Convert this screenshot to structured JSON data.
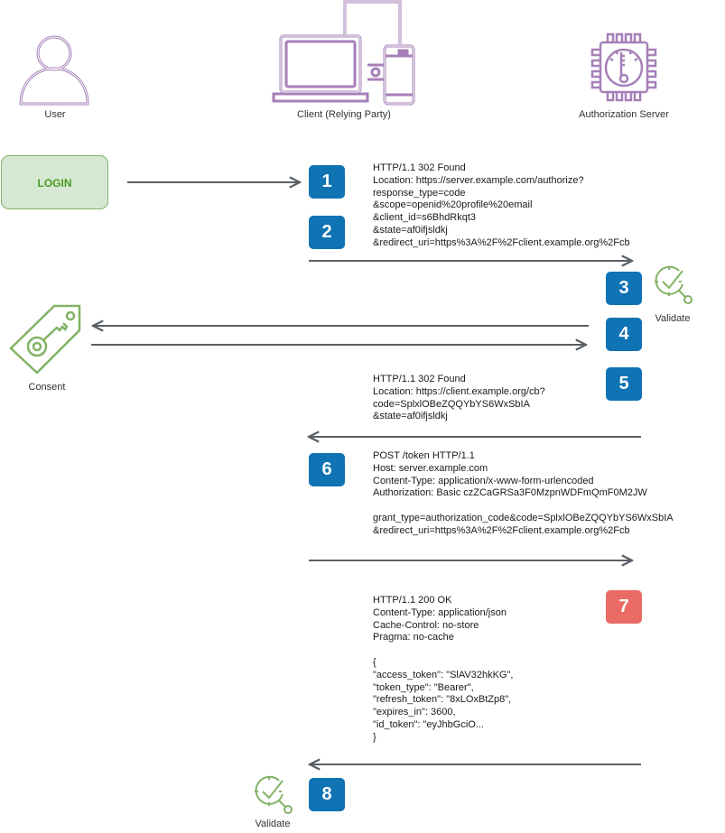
{
  "actors": {
    "user": "User",
    "client": "Client (Relying Party)",
    "server": "Authorization Server"
  },
  "login_button": "LOGIN",
  "consent_label": "Consent",
  "validate_label_server": "Validate",
  "validate_label_client": "Validate",
  "steps": {
    "s1": "1",
    "s2": "2",
    "s3": "3",
    "s4": "4",
    "s5": "5",
    "s6": "6",
    "s7": "7",
    "s8": "8"
  },
  "colors": {
    "step_blue": "#0f73b4",
    "step_red": "#ea6b66",
    "icon_purple": "#a680b8",
    "icon_green": "#82b366",
    "arrow": "#5a5f66"
  },
  "messages": {
    "authorize_request": [
      "HTTP/1.1 302 Found",
      "Location: https://server.example.com/authorize?",
      "response_type=code",
      "&scope=openid%20profile%20email",
      "&client_id=s6BhdRkqt3",
      "&state=af0ifjsldkj",
      "&redirect_uri=https%3A%2F%2Fclient.example.org%2Fcb"
    ],
    "callback_redirect": [
      "HTTP/1.1 302 Found",
      "Location: https://client.example.org/cb?",
      "code=SplxlOBeZQQYbYS6WxSbIA",
      "&state=af0ifjsldkj"
    ],
    "token_request": [
      "POST /token HTTP/1.1",
      "Host: server.example.com",
      "Content-Type: application/x-www-form-urlencoded",
      "Authorization: Basic czZCaGRSa3F0MzpnWDFmQmF0M2JW",
      "",
      "grant_type=authorization_code&code=SplxlOBeZQQYbYS6WxSbIA",
      "&redirect_uri=https%3A%2F%2Fclient.example.org%2Fcb"
    ],
    "token_response": [
      "HTTP/1.1 200 OK",
      "Content-Type: application/json",
      "Cache-Control: no-store",
      "Pragma: no-cache",
      "",
      "{",
      "\"access_token\": \"SlAV32hkKG\",",
      "\"token_type\": \"Bearer\",",
      "\"refresh_token\": \"8xLOxBtZp8\",",
      "\"expires_in\": 3600,",
      "\"id_token\": \"eyJhbGciO...",
      "}"
    ]
  }
}
